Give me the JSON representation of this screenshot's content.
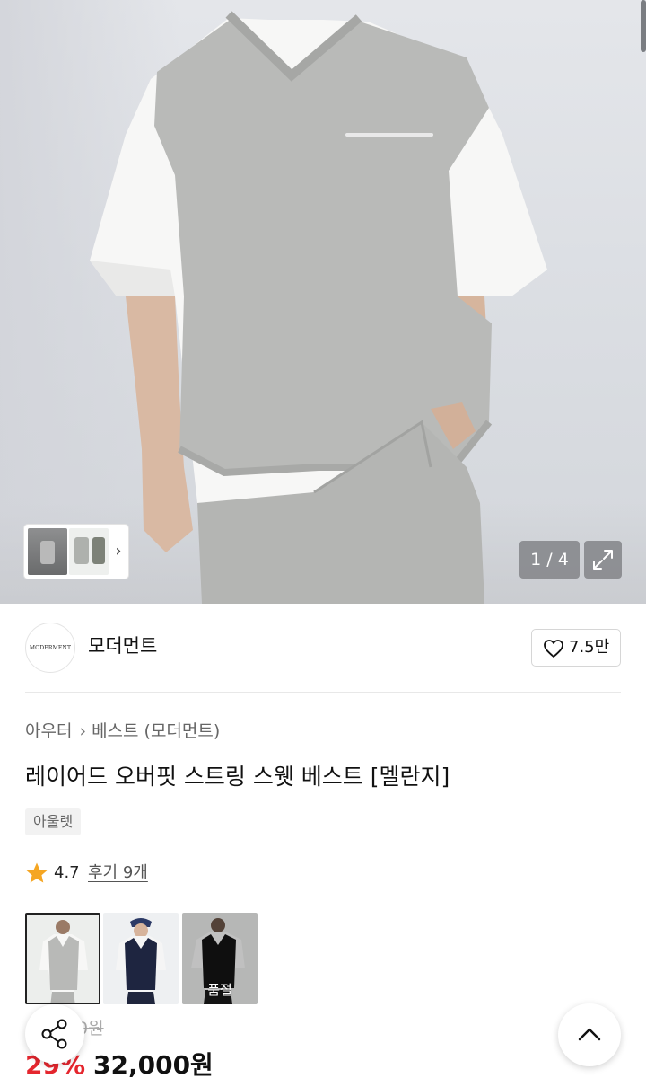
{
  "gallery": {
    "counter": "1 / 4",
    "thumbnail_next_icon": "chevron-right-icon",
    "expand_icon": "expand-icon"
  },
  "seller": {
    "logo_text": "MODERMENT",
    "name": "모더먼트",
    "like_icon": "heart-outline-icon",
    "like_count": "7.5만"
  },
  "breadcrumb": {
    "category": "아우터",
    "separator_icon": "chevron-right-icon",
    "subcategory": "베스트 (모더먼트)"
  },
  "product": {
    "title": "레이어드 오버핏 스트링 스웻 베스트 [멜란지]",
    "tag": "아울렛",
    "rating": "4.7",
    "reviews": "후기 9개",
    "rating_star_color": "#f5a623"
  },
  "options": [
    {
      "label": "",
      "selected": true,
      "sold_out": false
    },
    {
      "label": "",
      "selected": false,
      "sold_out": false
    },
    {
      "label": "품절",
      "selected": false,
      "sold_out": true
    }
  ],
  "price": {
    "original_partial": "0원",
    "discount": "29%",
    "sale_price": "32,000원",
    "discount_color": "#e5262e"
  },
  "floating": {
    "share_icon": "share-icon",
    "scroll_top_icon": "chevron-up-icon"
  }
}
